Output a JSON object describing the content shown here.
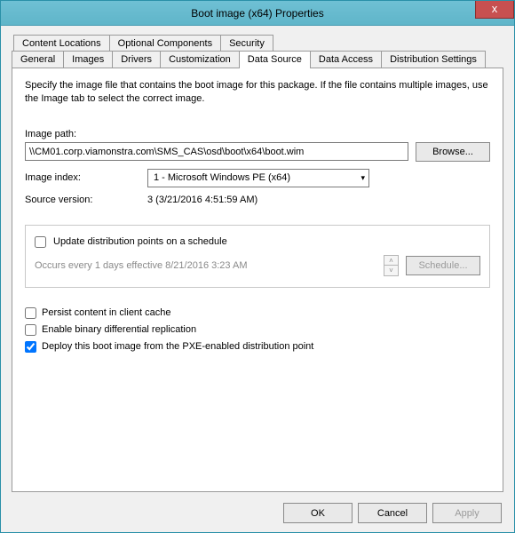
{
  "window": {
    "title": "Boot image (x64) Properties",
    "close": "x"
  },
  "tabs": {
    "row1": {
      "content_locations": "Content Locations",
      "optional_components": "Optional Components",
      "security": "Security"
    },
    "row2": {
      "general": "General",
      "images": "Images",
      "drivers": "Drivers",
      "customization": "Customization",
      "data_source": "Data Source",
      "data_access": "Data Access",
      "distribution_settings": "Distribution Settings"
    }
  },
  "panel": {
    "description": "Specify the image file that contains the boot image for this package. If the file contains multiple images, use the Image tab to select the correct image.",
    "image_path_label": "Image path:",
    "image_path_value": "\\\\CM01.corp.viamonstra.com\\SMS_CAS\\osd\\boot\\x64\\boot.wim",
    "browse_btn": "Browse...",
    "image_index_label": "Image index:",
    "image_index_value": "1 - Microsoft Windows PE (x64)",
    "source_version_label": "Source version:",
    "source_version_value": "3 (3/21/2016 4:51:59 AM)",
    "schedule_group": {
      "checkbox_label": "Update distribution points on a schedule",
      "occurs_text": "Occurs every 1 days effective 8/21/2016 3:23 AM",
      "schedule_btn": "Schedule..."
    },
    "checks": {
      "persist": "Persist content in client cache",
      "binary_diff": "Enable binary differential replication",
      "pxe_deploy": "Deploy this boot image from the PXE-enabled distribution point"
    }
  },
  "buttons": {
    "ok": "OK",
    "cancel": "Cancel",
    "apply": "Apply"
  }
}
